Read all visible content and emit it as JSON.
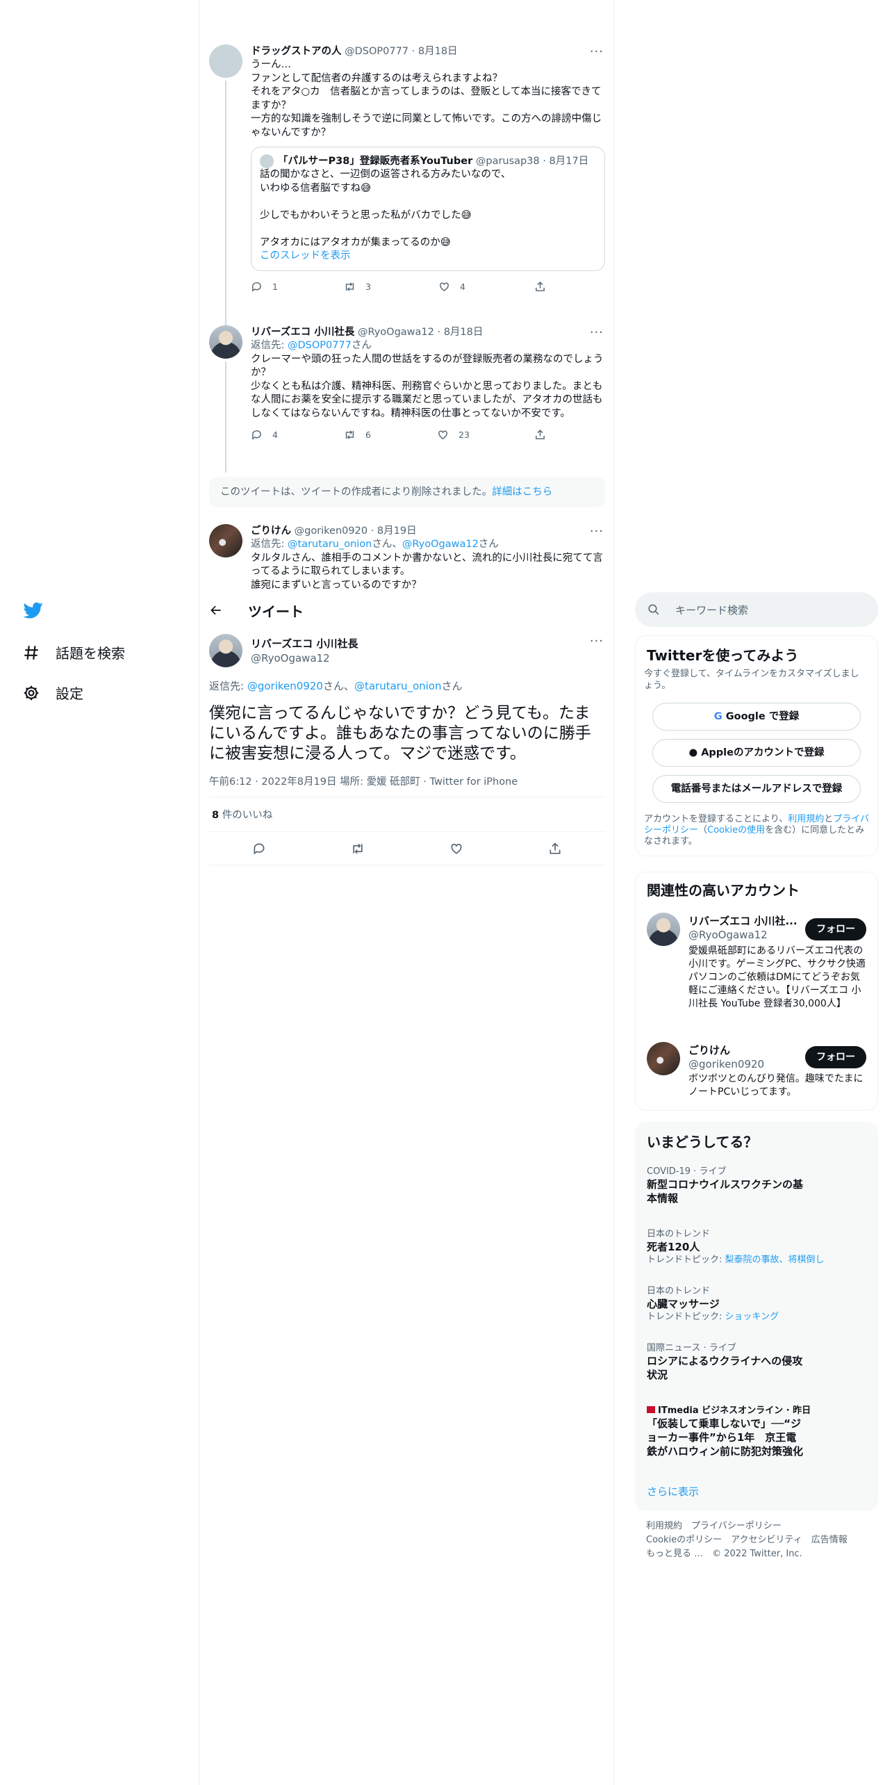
{
  "nav": {
    "explore": "話題を検索",
    "settings": "設定"
  },
  "thread": {
    "t1": {
      "name": "ドラッグストアの人",
      "handle": "@DSOP0777",
      "date": "· 8月18日",
      "lines": [
        "うーん…",
        "ファンとして配信者の弁護するのは考えられますよね？",
        "それをアタ○カ　信者脳とか言ってしまうのは、登販として本当に接客できてますか？",
        "一方的な知識を強制しそうで逆に同業として怖いです。この方への誹謗中傷じゃないんですか？"
      ],
      "quote": {
        "name": "「パルサーP38」登録販売者系YouTuber",
        "handle": "@parusap38",
        "date": "· 8月17日",
        "lines": [
          "話の聞かなさと、一辺倒の返答される方みたいなので、",
          "いわゆる信者脳ですね😅",
          "",
          "少しでもかわいそうと思った私がバカでした😅",
          "",
          "アタオカにはアタオカが集まってるのか😅"
        ],
        "show_thread": "このスレッドを表示"
      },
      "reply_count": "1",
      "retweet_count": "3",
      "like_count": "4"
    },
    "t2": {
      "name": "リバーズエコ 小川社長",
      "handle": "@RyoOgawa12",
      "date": "· 8月18日",
      "reply_prefix": "返信先: ",
      "reply_to": "@DSOP0777",
      "reply_suffix": "さん",
      "lines": [
        "クレーマーや頭の狂った人間の世話をするのが登録販売者の業務なのでしょうか？",
        "少なくとも私は介護、精神科医、刑務官ぐらいかと思っておりました。まともな人間にお薬を安全に提示する職業だと思っていましたが、アタオカの世話もしなくてはならないんですね。精神科医の仕事とってないか不安です。"
      ],
      "reply_count": "4",
      "retweet_count": "6",
      "like_count": "23"
    },
    "deleted_notice": "このツイートは、ツイートの作成者により削除されました。",
    "deleted_link": "詳細はこちら",
    "t3": {
      "name": "ごりけん",
      "handle": "@goriken0920",
      "date": "· 8月19日",
      "reply_prefix": "返信先: ",
      "reply_to_1": "@tarutaru_onion",
      "reply_mid": "さん、",
      "reply_to_2": "@RyoOgawa12",
      "reply_suffix": "さん",
      "lines": [
        "タルタルさん、誰相手のコメントか書かないと、流れ的に小川社長に宛てて言ってるように取られてしまいます。",
        "誰宛にまずいと言っているのですか？"
      ]
    }
  },
  "main_header": {
    "title": "ツイート"
  },
  "main_tweet": {
    "name": "リバーズエコ 小川社長",
    "handle": "@RyoOgawa12",
    "reply_prefix": "返信先: ",
    "reply_to_1": "@goriken0920",
    "reply_mid": "さん、",
    "reply_to_2": "@tarutaru_onion",
    "reply_suffix": "さん",
    "text": "僕宛に言ってるんじゃないですか？どう見ても。たまにいるんですよ。誰もあなたの事言ってないのに勝手に被害妄想に浸る人って。マジで迷惑です。",
    "meta": "午前6:12 · 2022年8月19日 場所: 愛媛 砥部町 · Twitter for iPhone",
    "likes_count": "8",
    "likes_label": " 件のいいね"
  },
  "search": {
    "placeholder": "キーワード検索"
  },
  "signup": {
    "title": "Twitterを使ってみよう",
    "desc": "今すぐ登録して、タイムラインをカスタマイズしましょう。",
    "google": "Google で登録",
    "apple": "Appleのアカウントで登録",
    "phone": "電話番号またはメールアドレスで登録",
    "legal_1": "アカウントを登録することにより、",
    "legal_terms": "利用規約",
    "legal_2": "と",
    "legal_privacy": "プライバシーポリシー",
    "legal_3": "（",
    "legal_cookie": "Cookieの使用",
    "legal_4": "を含む）に同意したとみなされます。"
  },
  "related": {
    "title": "関連性の高いアカウント",
    "accounts": [
      {
        "name": "リバーズエコ 小川社...",
        "handle": "@RyoOgawa12",
        "bio": "愛媛県砥部町にあるリバーズエコ代表の小川です。ゲーミングPC、サクサク快適パソコンのご依頼はDMにてどうぞお気軽にご連絡ください。【リバーズエコ 小川社長 YouTube 登録者30,000人】",
        "follow": "フォロー"
      },
      {
        "name": "ごりけん",
        "handle": "@goriken0920",
        "bio": "ボツボツとのんびり発信。趣味でたまにノートPCいじってます。",
        "follow": "フォロー"
      }
    ]
  },
  "trends": {
    "title": "いまどうしてる？",
    "items": [
      {
        "category": "COVID-19 · ライブ",
        "name": "新型コロナウイルスワクチンの基本情報",
        "sub_label": "",
        "sub_topics": ""
      },
      {
        "category": "日本のトレンド",
        "name": "死者120人",
        "sub_label": "トレンドトピック: ",
        "sub_topics": "梨泰院の事故、将棋倒し"
      },
      {
        "category": "日本のトレンド",
        "name": "心臓マッサージ",
        "sub_label": "トレンドトピック: ",
        "sub_topics": "ショッキング"
      },
      {
        "category": "国際ニュース · ライブ",
        "name": "ロシアによるウクライナへの侵攻状況",
        "sub_label": "",
        "sub_topics": ""
      },
      {
        "category": "ITmedia ビジネスオンライン · 昨日",
        "name": "「仮装して乗車しないで」──“ジョーカー事件”から1年　京王電鉄がハロウィン前に防犯対策強化",
        "sub_label": "",
        "sub_topics": ""
      }
    ],
    "show_more": "さらに表示"
  },
  "footer": {
    "links": [
      "利用規約",
      "プライバシーポリシー",
      "Cookieのポリシー",
      "アクセシビリティ",
      "広告情報",
      "もっと見る …"
    ],
    "copyright": "© 2022 Twitter, Inc."
  },
  "colors": {
    "accent": "#1d9bf0",
    "text": "#0f1419",
    "muted": "#536471",
    "border": "#eff3f4"
  }
}
